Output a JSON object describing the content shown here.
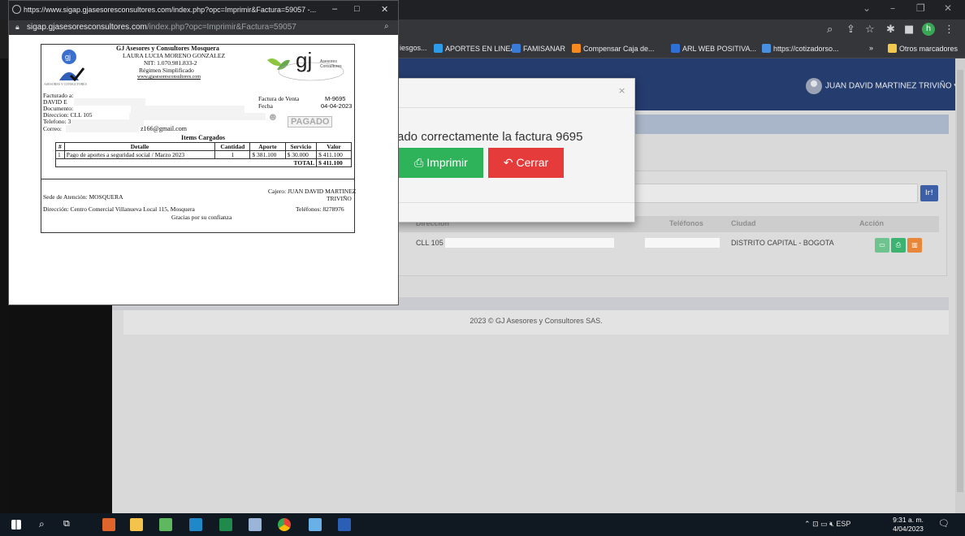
{
  "browser": {
    "bookmarks": [
      {
        "label": "iesgos...",
        "color": "#6b8fd6"
      },
      {
        "label": "APORTES EN LINEA",
        "color": "#2e9be8"
      },
      {
        "label": "FAMISANAR",
        "color": "#3a7bd5"
      },
      {
        "label": "Compensar Caja de...",
        "color": "#f58a1f"
      },
      {
        "label": "ARL WEB POSITIVA...",
        "color": "#2f6fd6"
      },
      {
        "label": "https://cotizadorso...",
        "color": "#4a90e2"
      },
      {
        "label": "»",
        "color": ""
      },
      {
        "label": "Otros marcadores",
        "color": "#f2c94c"
      }
    ],
    "profile_initial": "h"
  },
  "app": {
    "user_name": "JUAN DAVID MARTINEZ TRIVIÑO",
    "table": {
      "headers": [
        "Dirección",
        "Teléfonos",
        "Ciudad",
        "Acción"
      ],
      "row": {
        "address": "CLL 105",
        "city": "DISTRITO CAPITAL - BOGOTA"
      }
    },
    "search_button": "Ir!",
    "footer": "2023 © GJ Asesores y Consultores SAS."
  },
  "modal": {
    "message": "ado correctamente la factura 9695",
    "print_label": "Imprimir",
    "close_label": "Cerrar",
    "close_x": "×"
  },
  "popup": {
    "title": "https://www.sigap.gjasesoresconsultores.com/index.php?opc=Imprimir&Factura=59057 -...",
    "url_domain": "sigap.gjasesoresconsultores.com",
    "url_path": "/index.php?opc=Imprimir&Factura=59057"
  },
  "invoice": {
    "company": "GJ Asesores y Consultores Mosquera",
    "owner": "LAURA LUCIA MORENO GONZALEZ",
    "nit": "NIT: 1.070.981.833-2",
    "regime": "Régimen Simplificado",
    "website": "www.gjasesoresconsultores.com",
    "logo_left_text": "ASESORES Y CONSULTORES",
    "logo_right_brand": "gj",
    "logo_right_line1": "Asesores",
    "logo_right_line2": "Consultores",
    "billed_to_label": "Facturado a:",
    "client_name": "DAVID E",
    "document_label": "Documento:",
    "address_label": "Direccion: CLL 105",
    "phone_label": "Telefono: 311",
    "email_label": "Correo:",
    "email_value": "z166@gmail.com",
    "sale_label": "Factura de Venta",
    "sale_number": "M-9695",
    "date_label": "Fecha",
    "date_value": "04-04-2023",
    "paid_stamp": "PAGADO",
    "items_title": "Items Cargados",
    "columns": [
      "#",
      "Detalle",
      "Cantidad",
      "Aporte",
      "Servicio",
      "Valor"
    ],
    "items": [
      {
        "n": "1",
        "detail": "Pago de aportes a seguridad social / Marzo 2023",
        "qty": "1",
        "aporte": "$ 381.100",
        "servicio": "$ 30.000",
        "valor": "$ 411.100"
      }
    ],
    "total_label": "TOTAL",
    "total_value": "$ 411.100",
    "office_label": "Sede de Atención: MOSQUERA",
    "cashier_line1": "Cajero: JUAN DAVID MARTINEZ",
    "cashier_line2": "TRIVIÑO",
    "address_line": "Dirección: Centro Comercial Villanueva Local 115, Mosquera",
    "phones_line": "Teléfonos: 8278976",
    "thanks": "Gracias por su confianza"
  },
  "taskbar": {
    "language": "ESP",
    "time": "9:31 a. m.",
    "date": "4/04/2023"
  }
}
